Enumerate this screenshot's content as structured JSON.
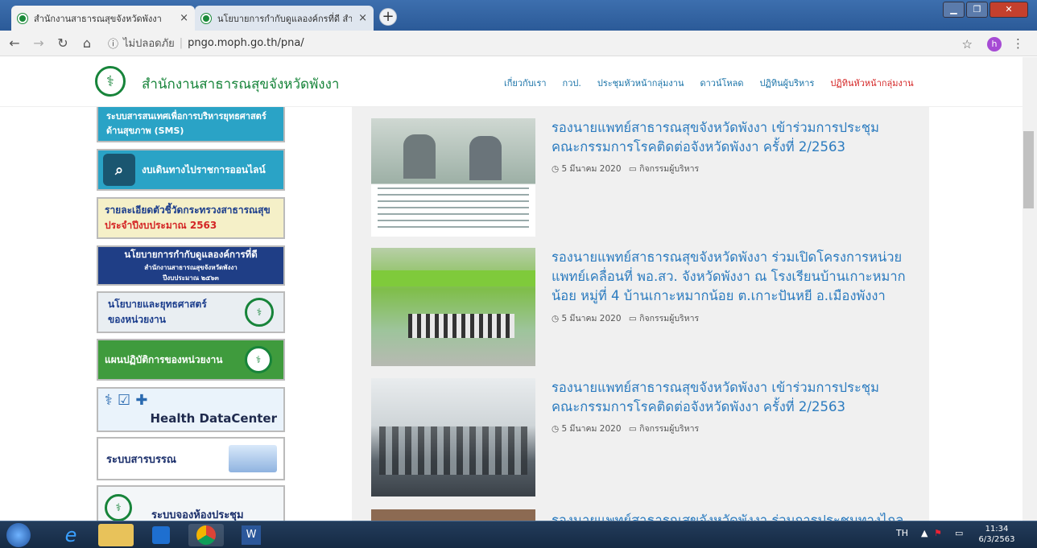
{
  "browser": {
    "tabs": [
      {
        "title": "สำนักงานสาธารณสุขจังหวัดพังงา",
        "close": "×"
      },
      {
        "title": "นโยบายการกำกับดูแลองค์กรที่ดี สำ",
        "close": "×"
      }
    ],
    "new_tab": "+",
    "security_label": "ไม่ปลอดภัย",
    "url": "pngo.moph.go.th/pna/",
    "avatar_letter": "h"
  },
  "site": {
    "title": "สำนักงานสาธารณสุขจังหวัดพังงา",
    "nav": [
      "เกี่ยวกับเรา",
      "กวป.",
      "ประชุมหัวหน้ากลุ่มงาน",
      "ดาวน์โหลด",
      "ปฏิทินผู้บริหาร",
      "ปฏิทินหัวหน้ากลุ่มงาน"
    ],
    "nav_active_color": "#d42525"
  },
  "sidebar": {
    "banners": [
      {
        "line1": "ระบบสารสนเทศเพื่อการบริหารยุทธศาสตร์",
        "line2": "ด้านสุขภาพ (SMS)"
      },
      {
        "text": "งบเดินทางไปราชการออนไลน์"
      },
      {
        "line1": "รายละเอียดตัวชี้วัดกระทรวงสาธารณสุข",
        "line2": "ประจำปีงบประมาณ 2563"
      },
      {
        "line1": "นโยบายการกำกับดูแลองค์การที่ดี",
        "line2": "สำนักงานสาธารณสุขจังหวัดพังงา",
        "line3": "ปีงบประมาณ ๒๕๖๓"
      },
      {
        "line1": "นโยบายและยุทธศาสตร์",
        "line2": "ของหน่วยงาน"
      },
      {
        "text": "แผนปฏิบัติการของหน่วยงาน"
      },
      {
        "text": "Health DataCenter"
      },
      {
        "text": "ระบบสารบรรณ"
      },
      {
        "text": "ระบบจองห้องประชุม"
      }
    ]
  },
  "posts": [
    {
      "title": "รองนายแพทย์สาธารณสุขจังหวัดพังงา เข้าร่วมการประชุมคณะกรรมการโรคติดต่อจังหวัดพังงา ครั้งที่ 2/2563",
      "date": "5 มีนาคม 2020",
      "category": "กิจกรรมผู้บริหาร"
    },
    {
      "title": "รองนายแพทย์สาธารณสุขจังหวัดพังงา ร่วมเปิดโครงการหน่วยแพทย์เคลื่อนที่ พอ.สว. จังหวัดพังงา ณ โรงเรียนบ้านเกาะหมากน้อย หมู่ที่ 4 บ้านเกาะหมากน้อย ต.เกาะปันหยี อ.เมืองพังงา",
      "date": "5 มีนาคม 2020",
      "category": "กิจกรรมผู้บริหาร"
    },
    {
      "title": "รองนายแพทย์สาธารณสุขจังหวัดพังงา เข้าร่วมการประชุมคณะกรรมการโรคติดต่อจังหวัดพังงา ครั้งที่ 2/2563",
      "date": "5 มีนาคม 2020",
      "category": "กิจกรรมผู้บริหาร"
    },
    {
      "title": "รองนายแพทย์สาธารณสุขจังหวัดพังงา ร่วมการประชุมทางไกล"
    }
  ],
  "taskbar": {
    "lang": "TH",
    "time": "11:34",
    "date": "6/3/2563"
  }
}
